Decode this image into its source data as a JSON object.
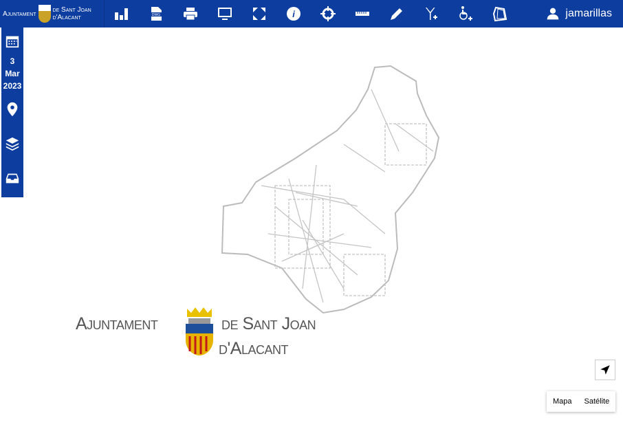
{
  "header": {
    "logo_line1_left": "Ajuntament",
    "logo_line1_right": "de Sant Joan",
    "logo_line2": "d'Alacant",
    "tools": [
      "chart-icon",
      "dwg-file-icon",
      "print-icon",
      "monitor-icon",
      "fullscreen-icon",
      "info-icon",
      "crosshair-icon",
      "ruler-icon",
      "pencil-icon",
      "antenna-add-icon",
      "accessibility-add-icon",
      "polygon-icon"
    ],
    "user": "jamarillas"
  },
  "sidebar": {
    "day": "3",
    "month": "Mar",
    "year": "2023"
  },
  "map": {
    "logo_left": "Ajuntament",
    "logo_right_1": "de Sant Joan",
    "logo_right_2": "d'Alacant",
    "map_type_buttons": [
      "Mapa",
      "Satélite"
    ]
  }
}
